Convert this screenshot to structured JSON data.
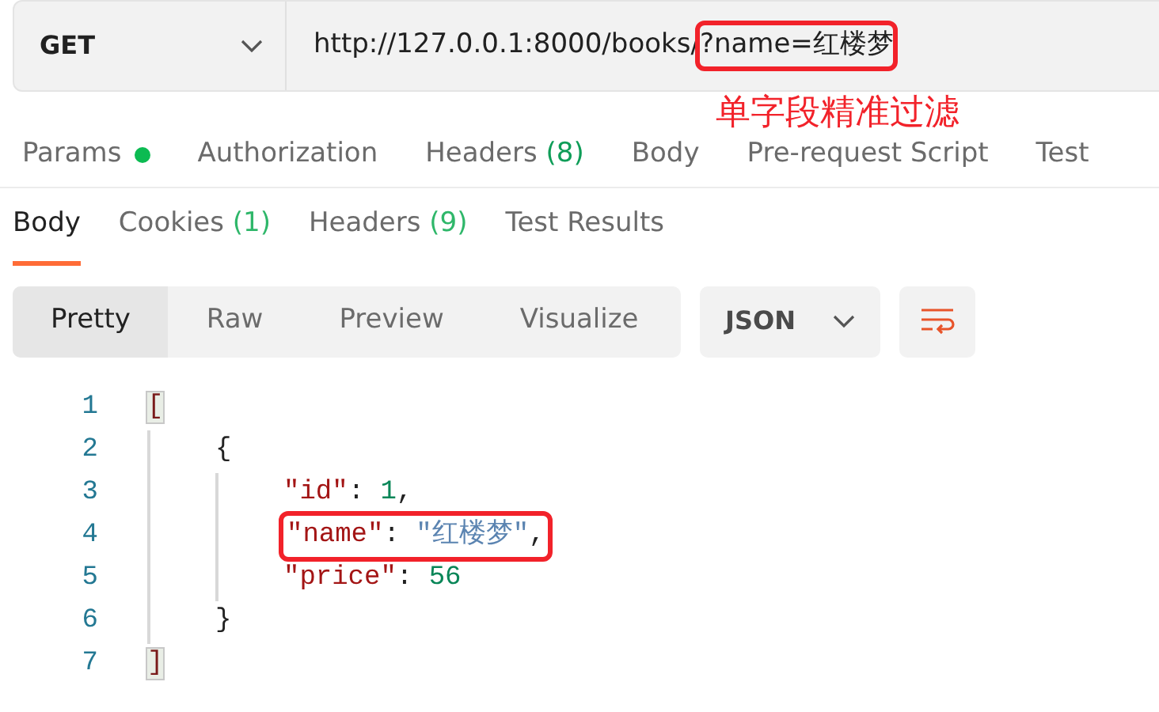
{
  "request": {
    "method": "GET",
    "url_base": "http://127.0.0.1:8000/books/",
    "url_query": "?name=红楼梦",
    "query_highlighted": true
  },
  "annotation": "单字段精准过滤",
  "request_tabs": [
    {
      "label": "Params",
      "dot": true
    },
    {
      "label": "Authorization",
      "dot": false
    },
    {
      "label": "Headers",
      "count": "(8)",
      "dot": false
    },
    {
      "label": "Body",
      "dot": false
    },
    {
      "label": "Pre-request Script",
      "dot": false
    },
    {
      "label": "Test",
      "dot": false
    }
  ],
  "response_tabs": [
    {
      "label": "Body",
      "selected": true
    },
    {
      "label": "Cookies",
      "count": "(1)",
      "selected": false
    },
    {
      "label": "Headers",
      "count": "(9)",
      "selected": false
    },
    {
      "label": "Test Results",
      "selected": false
    }
  ],
  "format_options": [
    {
      "label": "Pretty",
      "selected": true
    },
    {
      "label": "Raw",
      "selected": false
    },
    {
      "label": "Preview",
      "selected": false
    },
    {
      "label": "Visualize",
      "selected": false
    }
  ],
  "language": "JSON",
  "code": [
    {
      "number": "1",
      "tokens": [
        {
          "kind": "bracket",
          "text": "["
        }
      ],
      "highlighted": false,
      "children": [
        {
          "number": "2",
          "tokens": [
            {
              "kind": "punct",
              "text": "{"
            }
          ],
          "highlighted": false,
          "children": [
            {
              "number": "3",
              "tokens": [
                {
                  "kind": "key",
                  "text": "\"id\""
                },
                {
                  "kind": "punct",
                  "text": ": "
                },
                {
                  "kind": "number",
                  "text": "1"
                },
                {
                  "kind": "punct",
                  "text": ","
                }
              ],
              "highlighted": false
            },
            {
              "number": "4",
              "tokens": [
                {
                  "kind": "key",
                  "text": "\"name\""
                },
                {
                  "kind": "punct",
                  "text": ": "
                },
                {
                  "kind": "string",
                  "text": "\"红楼梦\""
                },
                {
                  "kind": "punct",
                  "text": ","
                }
              ],
              "highlighted": true
            },
            {
              "number": "5",
              "tokens": [
                {
                  "kind": "key",
                  "text": "\"price\""
                },
                {
                  "kind": "punct",
                  "text": ": "
                },
                {
                  "kind": "number",
                  "text": "56"
                }
              ],
              "highlighted": false
            }
          ]
        },
        {
          "number": "6",
          "tokens": [
            {
              "kind": "punct",
              "text": "}"
            }
          ],
          "highlighted": false
        }
      ]
    },
    {
      "number": "7",
      "tokens": [
        {
          "kind": "bracket",
          "text": "]"
        }
      ],
      "highlighted": false
    }
  ]
}
